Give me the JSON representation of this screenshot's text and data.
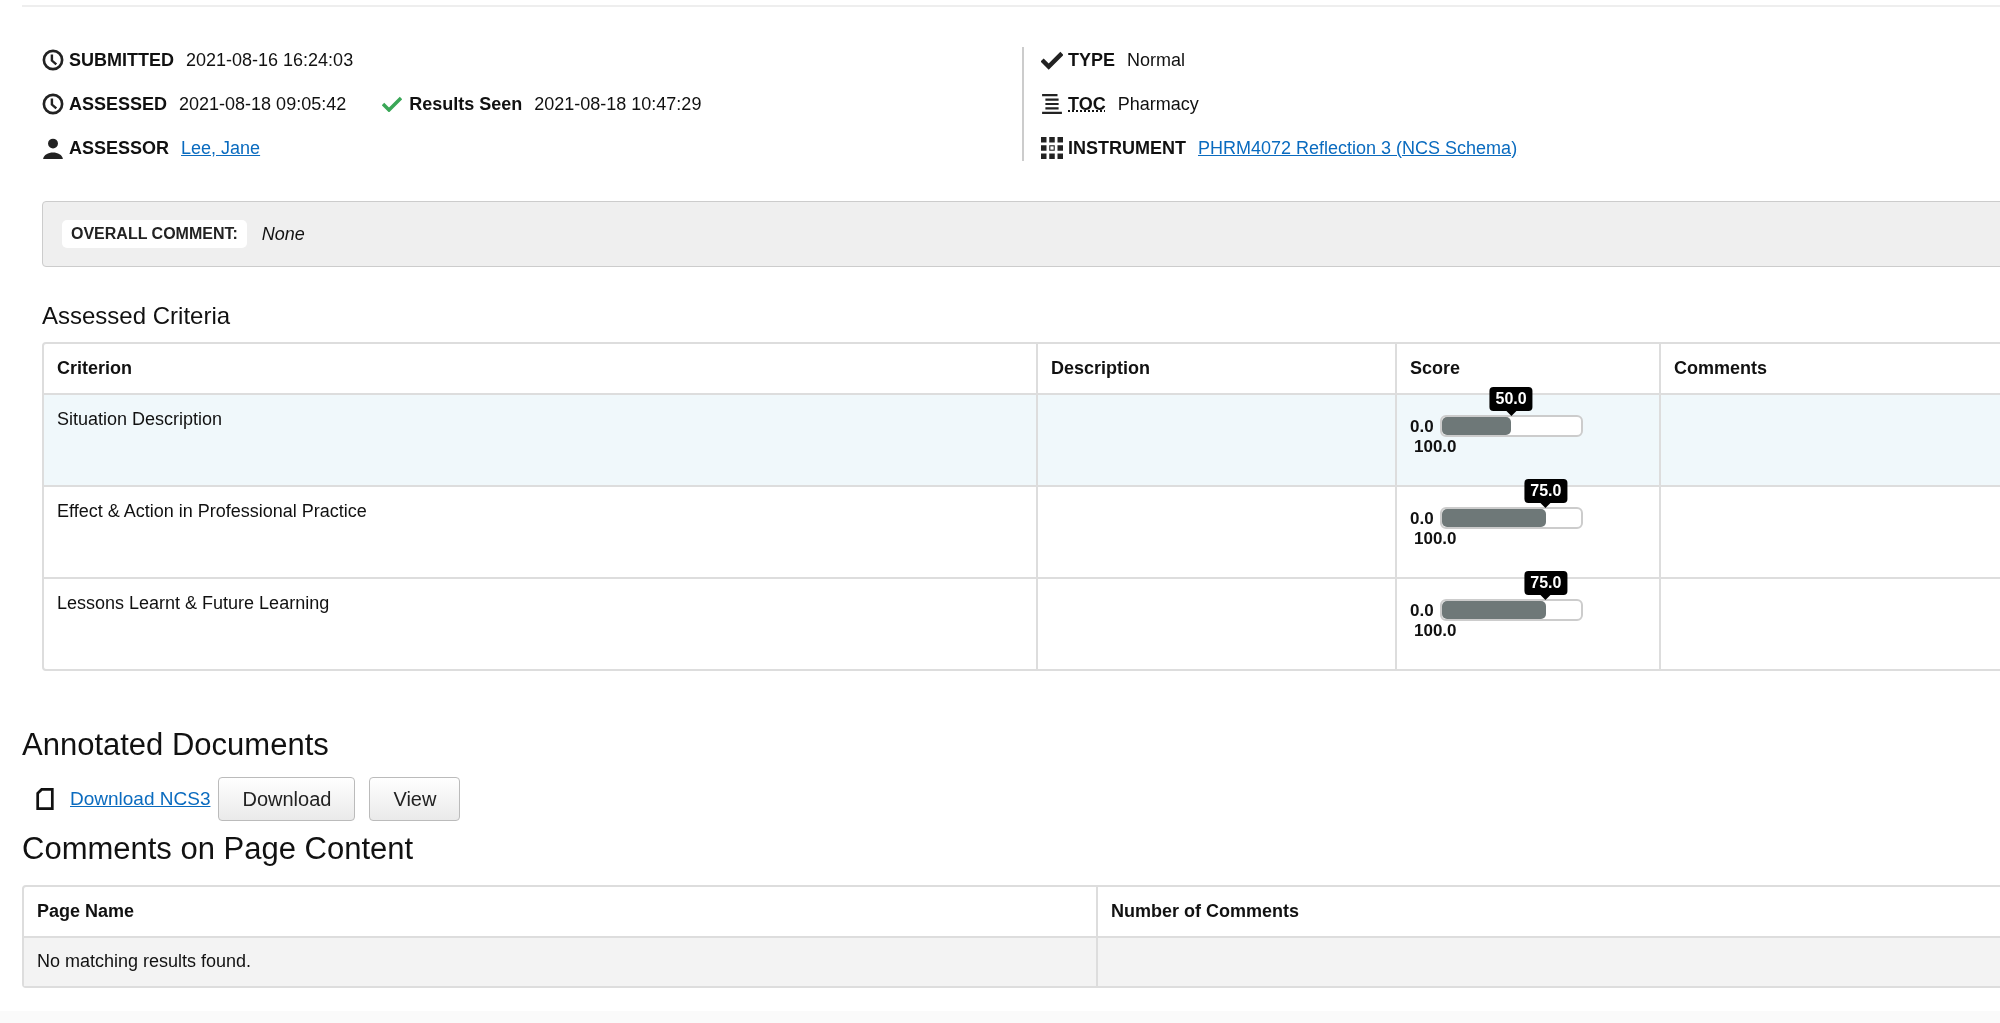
{
  "details_left": [
    {
      "label": "SUBMITTED",
      "kind": "text",
      "value": "2021-08-16 16:24:03"
    },
    {
      "label": "ASSESSED",
      "kind": "text",
      "value": "2021-08-18 09:05:42",
      "extra": {
        "label": "Results Seen",
        "value": "2021-08-18 10:47:29"
      }
    },
    {
      "label": "ASSESSOR",
      "kind": "link",
      "value": "Lee, Jane"
    }
  ],
  "details_right": [
    {
      "label": "TYPE",
      "kind": "text",
      "value": "Normal"
    },
    {
      "label": "TOC",
      "kind": "abbr",
      "value": "Pharmacy"
    },
    {
      "label": "INSTRUMENT",
      "kind": "link",
      "value": "PHRM4072 Reflection 3 (NCS Schema)"
    }
  ],
  "overall_comment": {
    "label": "OVERALL COMMENT:",
    "value": "None"
  },
  "criteria": {
    "title": "Assessed Criteria",
    "columns": [
      "Criterion",
      "Description",
      "Score",
      "Comments"
    ],
    "rows": [
      {
        "criterion": "Situation Description",
        "selected": true,
        "score": {
          "min": "0.0",
          "max": "100.0",
          "level": 0.5,
          "reading": "50.0"
        }
      },
      {
        "criterion": "Effect & Action in Professional Practice",
        "selected": false,
        "score": {
          "min": "0.0",
          "max": "100.0",
          "level": 0.75,
          "reading": "75.0"
        }
      },
      {
        "criterion": "Lessons Learnt & Future Learning",
        "selected": false,
        "score": {
          "min": "0.0",
          "max": "100.0",
          "level": 0.75,
          "reading": "75.0"
        }
      }
    ]
  },
  "annotated_documents": {
    "title": "Annotated Documents",
    "link": "Download NCS3",
    "buttons": [
      "Download",
      "View"
    ]
  },
  "page_comments": {
    "title": "Comments on Page Content",
    "columns": [
      "Page Name",
      "Number of Comments"
    ],
    "empty_message": "No matching results found."
  }
}
